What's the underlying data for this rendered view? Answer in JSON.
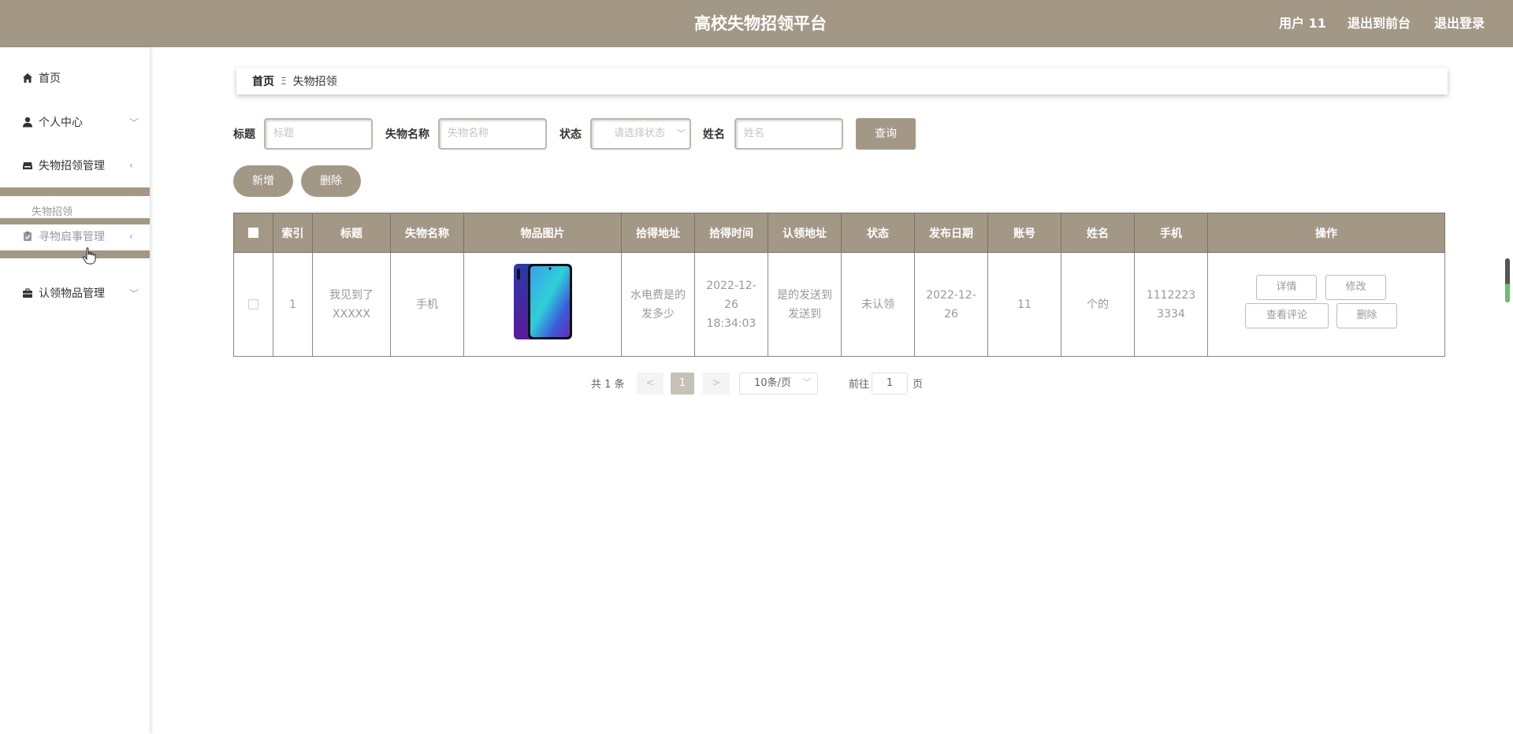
{
  "header": {
    "title": "高校失物招领平台",
    "user": "用户 11",
    "to_front": "退出到前台",
    "logout": "退出登录"
  },
  "sidebar": {
    "items": [
      {
        "label": "首页",
        "icon": "home-icon"
      },
      {
        "label": "个人中心",
        "icon": "user-icon"
      },
      {
        "label": "失物招领管理",
        "icon": "inbox-icon"
      },
      {
        "label": "失物招领",
        "icon": ""
      },
      {
        "label": "寻物启事管理",
        "icon": "clipboard-icon"
      },
      {
        "label": "认领物品管理",
        "icon": "briefcase-icon"
      }
    ]
  },
  "breadcrumb": {
    "home": "首页",
    "separator": "Ξ",
    "current": "失物招领"
  },
  "search": {
    "title_label": "标题",
    "title_placeholder": "标题",
    "item_label": "失物名称",
    "item_placeholder": "失物名称",
    "status_label": "状态",
    "status_placeholder": "请选择状态",
    "name_label": "姓名",
    "name_placeholder": "姓名",
    "query_button": "查询"
  },
  "actions": {
    "add": "新增",
    "delete": "删除"
  },
  "table": {
    "headers": [
      "索引",
      "标题",
      "失物名称",
      "物品图片",
      "拾得地址",
      "拾得时间",
      "认领地址",
      "状态",
      "发布日期",
      "账号",
      "姓名",
      "手机",
      "操作"
    ],
    "rows": [
      {
        "index": "1",
        "title": "我见到了XXXXX",
        "item": "手机",
        "image": "phone-image",
        "found_address": "水电费是的发多少",
        "found_time": "2022-12-26 18:34:03",
        "claim_address": "是的发送到发送到",
        "status": "未认领",
        "publish_date": "2022-12-26",
        "account": "11",
        "name": "个的",
        "phone": "11122233334",
        "ops": [
          "详情",
          "修改",
          "查看评论",
          "删除"
        ]
      }
    ]
  },
  "pagination": {
    "total": "共 1 条",
    "prev": "<",
    "current": "1",
    "next": ">",
    "page_size": "10条/页",
    "goto_label": "前往",
    "goto_value": "1",
    "page_unit": "页"
  },
  "colors": {
    "accent": "#a39886"
  }
}
